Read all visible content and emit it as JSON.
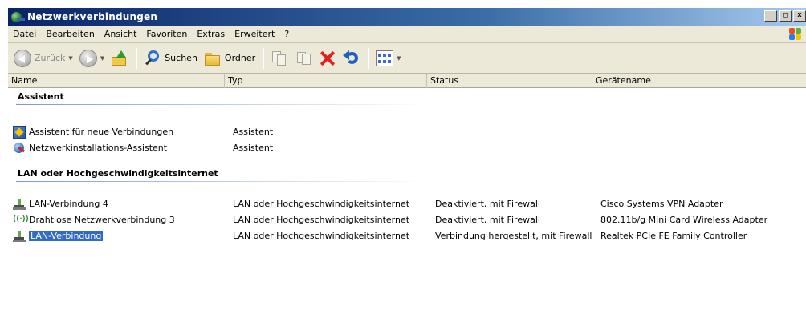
{
  "window": {
    "title": "Netzwerkverbindungen",
    "controls": {
      "minimize": "_",
      "maximize": "□",
      "close": "x"
    }
  },
  "menu": [
    {
      "label": "Datei",
      "accel": "D"
    },
    {
      "label": "Bearbeiten",
      "accel": "B"
    },
    {
      "label": "Ansicht",
      "accel": "A"
    },
    {
      "label": "Favoriten",
      "accel": "F"
    },
    {
      "label": "Extras",
      "accel": "x"
    },
    {
      "label": "Erweitert",
      "accel": "E"
    },
    {
      "label": "?",
      "accel": "?"
    }
  ],
  "toolbar": {
    "back_label": "Zurück",
    "search_label": "Suchen",
    "folders_label": "Ordner"
  },
  "columns": {
    "name": "Name",
    "typ": "Typ",
    "status": "Status",
    "geraetename": "Gerätename"
  },
  "groups": [
    {
      "title": "Assistent",
      "items": [
        {
          "name": "Assistent für neue Verbindungen",
          "typ": "Assistent",
          "status": "",
          "device": "",
          "icon": "wizard-icon"
        },
        {
          "name": "Netzwerkinstallations-Assistent",
          "typ": "Assistent",
          "status": "",
          "device": "",
          "icon": "network-wizard-icon"
        }
      ]
    },
    {
      "title": "LAN oder Hochgeschwindigkeitsinternet",
      "items": [
        {
          "name": "LAN-Verbindung 4",
          "typ": "LAN oder Hochgeschwindigkeitsinternet",
          "status": "Deaktiviert, mit Firewall",
          "device": "Cisco Systems VPN Adapter",
          "icon": "lan-icon"
        },
        {
          "name": "Drahtlose Netzwerkverbindung 3",
          "typ": "LAN oder Hochgeschwindigkeitsinternet",
          "status": "Deaktiviert, mit Firewall",
          "device": "802.11b/g Mini Card Wireless Adapter",
          "icon": "wireless-icon"
        },
        {
          "name": "LAN-Verbindung",
          "typ": "LAN oder Hochgeschwindigkeitsinternet",
          "status": "Verbindung hergestellt, mit Firewall",
          "device": "Realtek PCIe FE Family Controller",
          "icon": "lan-icon",
          "selected": true
        }
      ]
    }
  ],
  "colors": {
    "selection": "#316ac5",
    "titlebar_start": "#0a246a",
    "titlebar_end": "#a6caf0",
    "chrome": "#ece9d8",
    "delete": "#e02020"
  }
}
